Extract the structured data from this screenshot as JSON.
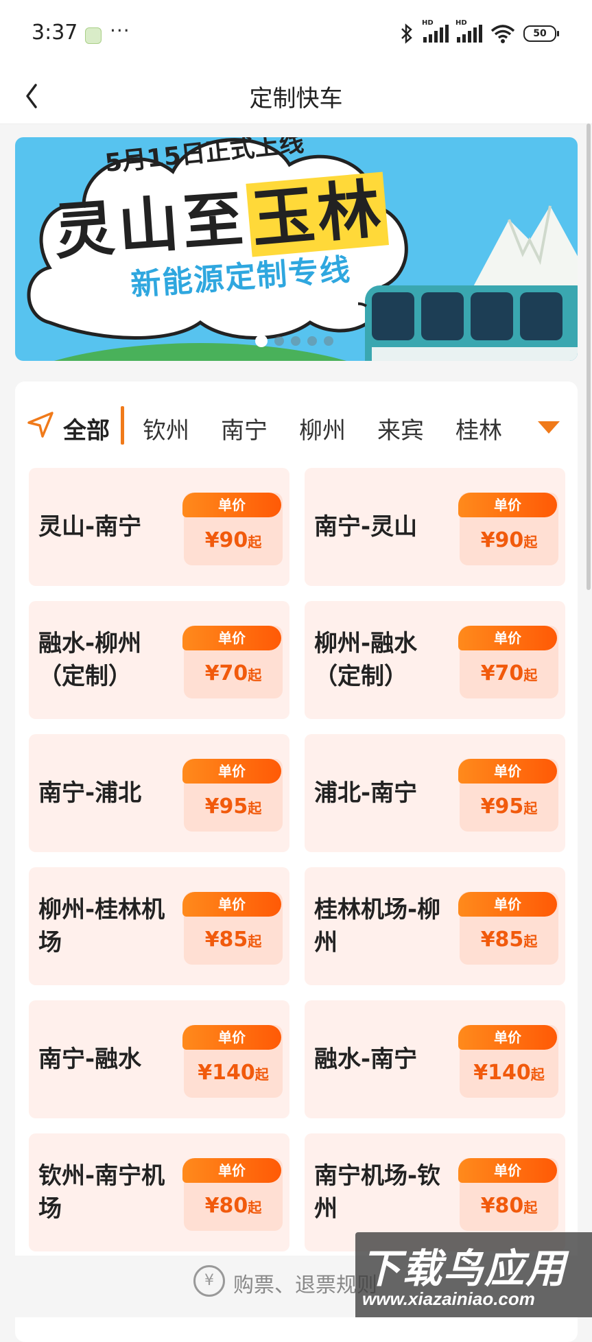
{
  "status_bar": {
    "time": "3:37",
    "dots": "···",
    "hd_label": "HD",
    "battery": "50"
  },
  "nav": {
    "title": "定制快车",
    "back_icon": "chevron-left-icon"
  },
  "banner": {
    "subtitle": "5月15日正式上线",
    "title_part1": "灵山至",
    "title_part2": "玉林",
    "tagline": "新能源定制专线",
    "active_slide": 1,
    "slide_count": 5
  },
  "city_tabs": {
    "items": [
      "全部",
      "钦州",
      "南宁",
      "柳州",
      "来宾",
      "桂林"
    ],
    "active": "全部"
  },
  "routes": [
    {
      "name": "灵山-南宁",
      "tag": "单价",
      "price": "¥90",
      "suffix": "起"
    },
    {
      "name": "南宁-灵山",
      "tag": "单价",
      "price": "¥90",
      "suffix": "起"
    },
    {
      "name": "融水-柳州（定制）",
      "tag": "单价",
      "price": "¥70",
      "suffix": "起"
    },
    {
      "name": "柳州-融水（定制）",
      "tag": "单价",
      "price": "¥70",
      "suffix": "起"
    },
    {
      "name": "南宁-浦北",
      "tag": "单价",
      "price": "¥95",
      "suffix": "起"
    },
    {
      "name": "浦北-南宁",
      "tag": "单价",
      "price": "¥95",
      "suffix": "起"
    },
    {
      "name": "柳州-桂林机场",
      "tag": "单价",
      "price": "¥85",
      "suffix": "起"
    },
    {
      "name": "桂林机场-柳州",
      "tag": "单价",
      "price": "¥85",
      "suffix": "起"
    },
    {
      "name": "南宁-融水",
      "tag": "单价",
      "price": "¥140",
      "suffix": "起"
    },
    {
      "name": "融水-南宁",
      "tag": "单价",
      "price": "¥140",
      "suffix": "起"
    },
    {
      "name": "钦州-南宁机场",
      "tag": "单价",
      "price": "¥80",
      "suffix": "起"
    },
    {
      "name": "南宁机场-钦州",
      "tag": "单价",
      "price": "¥80",
      "suffix": "起"
    }
  ],
  "bottom": {
    "notice": "购票、退票规则",
    "icon": "yen-circle-icon"
  },
  "watermark": {
    "title": "下载鸟应用",
    "url": "www.xiazainiao.com"
  },
  "colors": {
    "accent": "#f15a0c",
    "tag_gradient_start": "#ff8a1c",
    "tag_gradient_end": "#ff5a06",
    "item_bg": "#fff0ec",
    "price_bg": "#ffdfd3",
    "banner_bg": "#57c3ef"
  }
}
